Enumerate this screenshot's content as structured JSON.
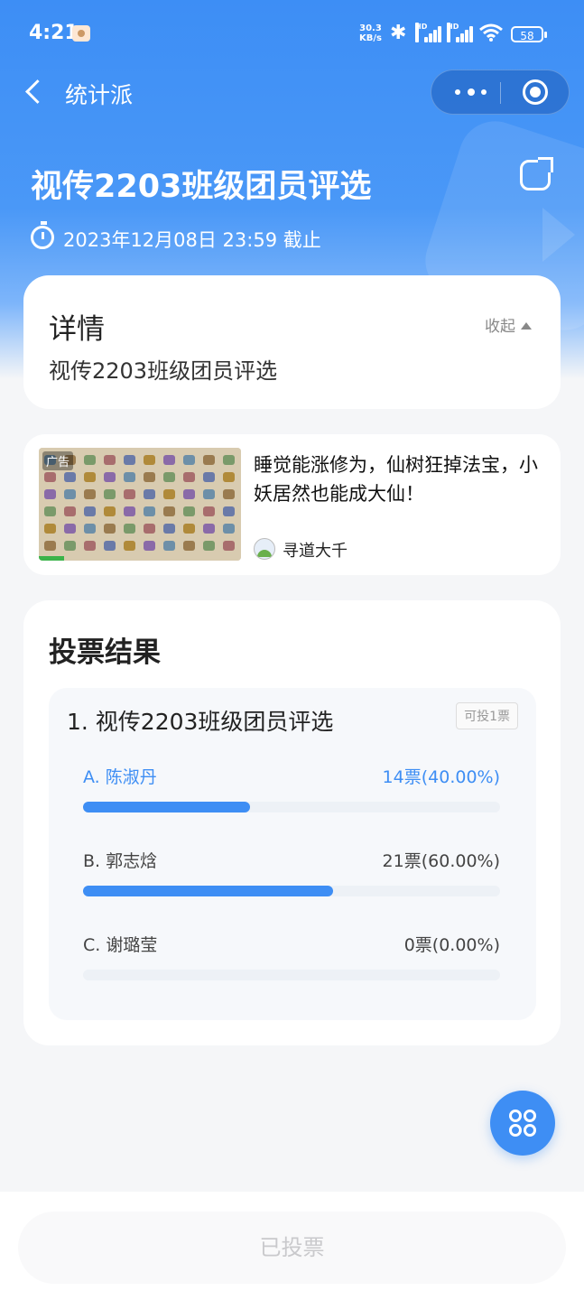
{
  "status_bar": {
    "time": "4:21",
    "net_speed_value": "30.3",
    "net_speed_unit": "KB/s",
    "signal_label": "HD",
    "battery": "58"
  },
  "nav": {
    "title": "统计派"
  },
  "poll": {
    "title": "视传2203班级团员评选",
    "deadline": "2023年12月08日 23:59 截止"
  },
  "details": {
    "heading": "详情",
    "collapse_label": "收起",
    "description": "视传2203班级团员评选"
  },
  "ad": {
    "badge": "广告",
    "headline": "睡觉能涨修为，仙树狂掉法宝，小妖居然也能成大仙！",
    "source": "寻道大千"
  },
  "results": {
    "heading": "投票结果",
    "question": "1. 视传2203班级团员评选",
    "limit": "可投1票",
    "options": [
      {
        "label": "A. 陈淑丹",
        "count": "14票(40.00%)",
        "share": 0.4,
        "selected": true
      },
      {
        "label": "B. 郭志焓",
        "count": "21票(60.00%)",
        "share": 0.6,
        "selected": false
      },
      {
        "label": "C. 谢璐莹",
        "count": "0票(0.00%)",
        "share": 0.0,
        "selected": false
      }
    ]
  },
  "footer": {
    "button_label": "已投票"
  },
  "colors": {
    "accent": "#3e8ef4",
    "hero_top": "#3d8ef5",
    "page_bg": "#f5f6f8"
  },
  "icons": [
    "back-icon",
    "more-icon",
    "close-miniprogram-icon",
    "share-icon",
    "clock-icon",
    "collapse-arrow-icon",
    "grid-menu-icon"
  ]
}
